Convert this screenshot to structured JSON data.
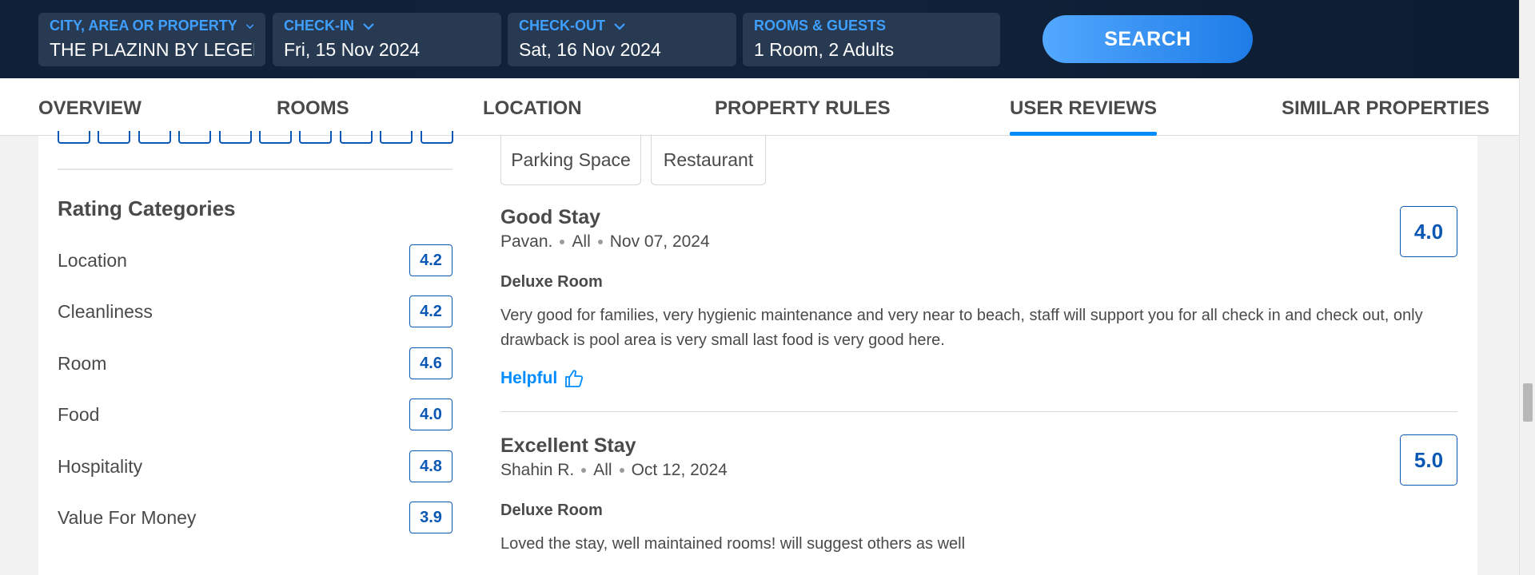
{
  "search": {
    "city": {
      "label": "CITY, AREA OR PROPERTY",
      "value": "THE PLAZINN BY LEGEND"
    },
    "checkin": {
      "label": "CHECK-IN",
      "value": "Fri, 15 Nov 2024"
    },
    "checkout": {
      "label": "CHECK-OUT",
      "value": "Sat, 16 Nov 2024"
    },
    "rooms": {
      "label": "ROOMS & GUESTS",
      "value": "1 Room, 2 Adults"
    },
    "button": "SEARCH"
  },
  "tabs": [
    {
      "label": "OVERVIEW",
      "active": false
    },
    {
      "label": "ROOMS",
      "active": false
    },
    {
      "label": "LOCATION",
      "active": false
    },
    {
      "label": "PROPERTY RULES",
      "active": false
    },
    {
      "label": "USER REVIEWS",
      "active": true
    },
    {
      "label": "SIMILAR PROPERTIES",
      "active": false
    }
  ],
  "rating_categories": {
    "title": "Rating Categories",
    "items": [
      {
        "label": "Location",
        "score": "4.2"
      },
      {
        "label": "Cleanliness",
        "score": "4.2"
      },
      {
        "label": "Room",
        "score": "4.6"
      },
      {
        "label": "Food",
        "score": "4.0"
      },
      {
        "label": "Hospitality",
        "score": "4.8"
      },
      {
        "label": "Value For Money",
        "score": "3.9"
      }
    ]
  },
  "tags": [
    "Parking Space",
    "Restaurant"
  ],
  "reviews": [
    {
      "title": "Good Stay",
      "author": "Pavan.",
      "traveller_type": "All",
      "date": "Nov 07, 2024",
      "room": "Deluxe Room",
      "text": "Very good for families, very hygienic maintenance and very near to beach, staff will support you for all check in and check out, only drawback is pool area is very small last food is very good here.",
      "score": "4.0",
      "helpful_label": "Helpful"
    },
    {
      "title": "Excellent Stay",
      "author": "Shahin R.",
      "traveller_type": "All",
      "date": "Oct 12, 2024",
      "room": "Deluxe Room",
      "text": "Loved the stay, well maintained rooms! will suggest others as well",
      "score": "5.0"
    }
  ],
  "colors": {
    "accent": "#008cff",
    "score_blue": "#0b58b4",
    "header_bg": "#10223a"
  }
}
